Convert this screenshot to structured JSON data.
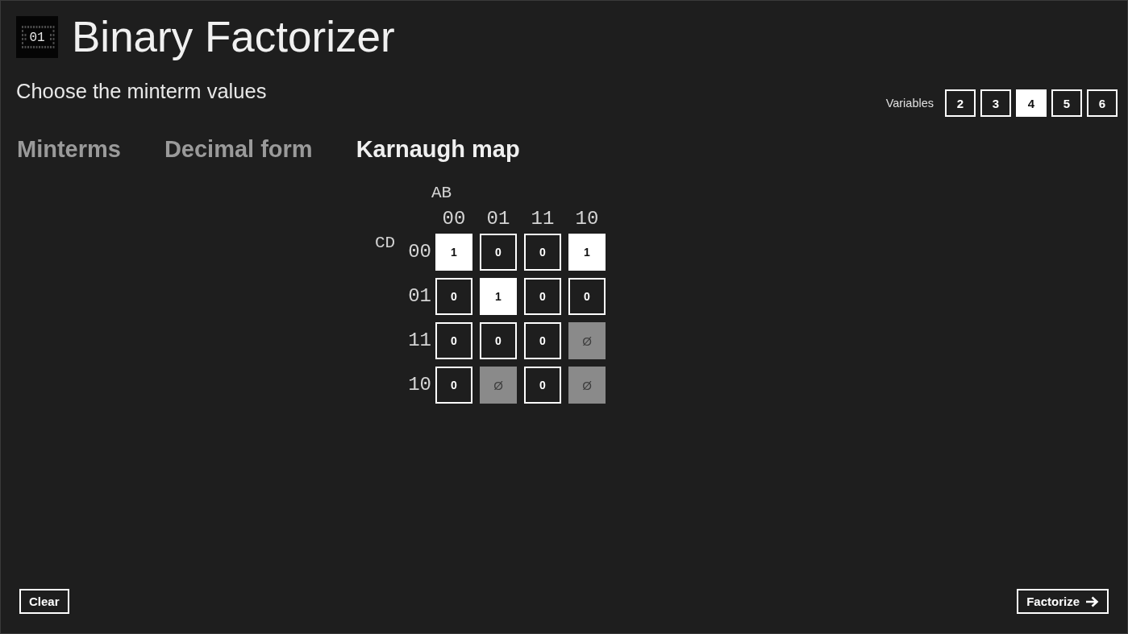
{
  "app": {
    "icon_text": "01",
    "title": "Binary Factorizer"
  },
  "subtitle": "Choose the minterm values",
  "variables": {
    "label": "Variables",
    "options": [
      {
        "label": "2",
        "selected": false
      },
      {
        "label": "3",
        "selected": false
      },
      {
        "label": "4",
        "selected": true
      },
      {
        "label": "5",
        "selected": false
      },
      {
        "label": "6",
        "selected": false
      }
    ]
  },
  "tabs": [
    {
      "label": "Minterms",
      "selected": false
    },
    {
      "label": "Decimal form",
      "selected": false
    },
    {
      "label": "Karnaugh map",
      "selected": true
    }
  ],
  "karnaugh_map": {
    "column_variables": "AB",
    "row_variables": "CD",
    "column_labels": [
      "00",
      "01",
      "11",
      "10"
    ],
    "rows": [
      {
        "label": "00",
        "cells": [
          {
            "value": "1",
            "kind": "one"
          },
          {
            "value": "0",
            "kind": "zero"
          },
          {
            "value": "0",
            "kind": "zero"
          },
          {
            "value": "1",
            "kind": "one"
          }
        ]
      },
      {
        "label": "01",
        "cells": [
          {
            "value": "0",
            "kind": "zero"
          },
          {
            "value": "1",
            "kind": "one"
          },
          {
            "value": "0",
            "kind": "zero"
          },
          {
            "value": "0",
            "kind": "zero"
          }
        ]
      },
      {
        "label": "11",
        "cells": [
          {
            "value": "0",
            "kind": "zero"
          },
          {
            "value": "0",
            "kind": "zero"
          },
          {
            "value": "0",
            "kind": "zero"
          },
          {
            "value": "Ø",
            "kind": "dont_care"
          }
        ]
      },
      {
        "label": "10",
        "cells": [
          {
            "value": "0",
            "kind": "zero"
          },
          {
            "value": "Ø",
            "kind": "dont_care"
          },
          {
            "value": "0",
            "kind": "zero"
          },
          {
            "value": "Ø",
            "kind": "dont_care"
          }
        ]
      }
    ]
  },
  "buttons": [
    {
      "label": "Clear",
      "kind": "plain"
    },
    {
      "label": "Factorize",
      "kind": "next"
    }
  ]
}
